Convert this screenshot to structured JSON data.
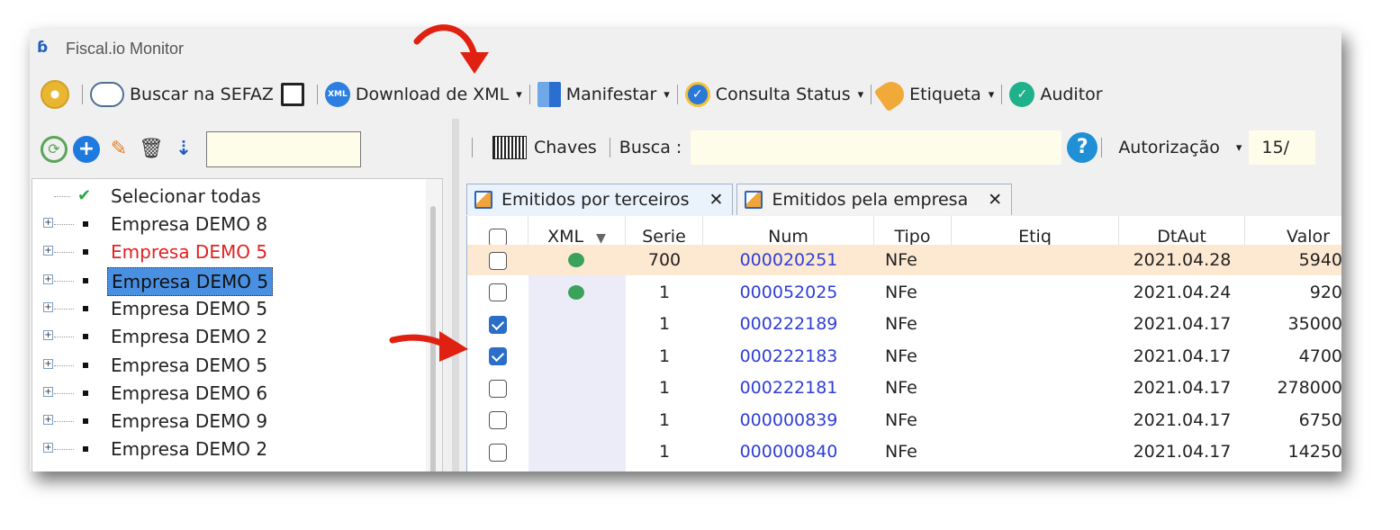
{
  "window": {
    "title": "Fiscal.io Monitor",
    "logo_glyph": "ɓ"
  },
  "toolbar": {
    "buscar_sefaz": "Buscar na SEFAZ",
    "download_xml": "Download de XML",
    "manifestar": "Manifestar",
    "consulta_status": "Consulta Status",
    "etiqueta": "Etiqueta",
    "auditor": "Auditor",
    "xml_icon_text": "XML",
    "caret": "▾"
  },
  "left_tools": {
    "refresh": "⟳",
    "add": "+",
    "edit": "✎",
    "delete": "🗑",
    "sort": "⇣"
  },
  "tree": {
    "select_all": "Selecionar todas",
    "expander": "+",
    "items": [
      {
        "label": "Empresa DEMO 8",
        "style": "normal"
      },
      {
        "label": "Empresa DEMO 5",
        "style": "red"
      },
      {
        "label": "Empresa DEMO 5",
        "style": "selected"
      },
      {
        "label": "Empresa DEMO 5",
        "style": "normal"
      },
      {
        "label": "Empresa DEMO 2",
        "style": "normal"
      },
      {
        "label": "Empresa DEMO 5",
        "style": "normal"
      },
      {
        "label": "Empresa DEMO 6",
        "style": "normal"
      },
      {
        "label": "Empresa DEMO 9",
        "style": "normal"
      },
      {
        "label": "Empresa DEMO 2",
        "style": "normal"
      }
    ]
  },
  "searchbar": {
    "chaves": "Chaves",
    "busca_label": "Busca :",
    "help": "?",
    "autorizacao": "Autorização",
    "caret": "▾",
    "date_partial": "15/"
  },
  "tabs": [
    {
      "label": "Emitidos por terceiros",
      "close": "✕",
      "active": true
    },
    {
      "label": "Emitidos pela empresa",
      "close": "✕",
      "active": false
    }
  ],
  "grid": {
    "headers": {
      "xml": "XML",
      "xml_sort": "▼",
      "serie": "Serie",
      "num": "Num",
      "tipo": "Tipo",
      "etiq": "Etiq",
      "dtaut": "DtAut",
      "valor": "Valor"
    },
    "rows": [
      {
        "checked": false,
        "xml": true,
        "serie": "700",
        "num": "000020251",
        "tipo": "NFe",
        "dtaut": "2021.04.28",
        "valor": "5940",
        "highlight": true
      },
      {
        "checked": false,
        "xml": true,
        "serie": "1",
        "num": "000052025",
        "tipo": "NFe",
        "dtaut": "2021.04.24",
        "valor": "920",
        "highlight": false
      },
      {
        "checked": true,
        "xml": false,
        "serie": "1",
        "num": "000222189",
        "tipo": "NFe",
        "dtaut": "2021.04.17",
        "valor": "35000",
        "highlight": false
      },
      {
        "checked": true,
        "xml": false,
        "serie": "1",
        "num": "000222183",
        "tipo": "NFe",
        "dtaut": "2021.04.17",
        "valor": "4700",
        "highlight": false
      },
      {
        "checked": false,
        "xml": false,
        "serie": "1",
        "num": "000222181",
        "tipo": "NFe",
        "dtaut": "2021.04.17",
        "valor": "278000",
        "highlight": false
      },
      {
        "checked": false,
        "xml": false,
        "serie": "1",
        "num": "000000839",
        "tipo": "NFe",
        "dtaut": "2021.04.17",
        "valor": "6750",
        "highlight": false
      },
      {
        "checked": false,
        "xml": false,
        "serie": "1",
        "num": "000000840",
        "tipo": "NFe",
        "dtaut": "2021.04.17",
        "valor": "14250",
        "highlight": false
      }
    ]
  },
  "colors": {
    "accent_blue": "#2a6ec8",
    "link_blue": "#2f3fd6",
    "annotation_red": "#e02010",
    "input_yellow": "#fdfdea"
  }
}
